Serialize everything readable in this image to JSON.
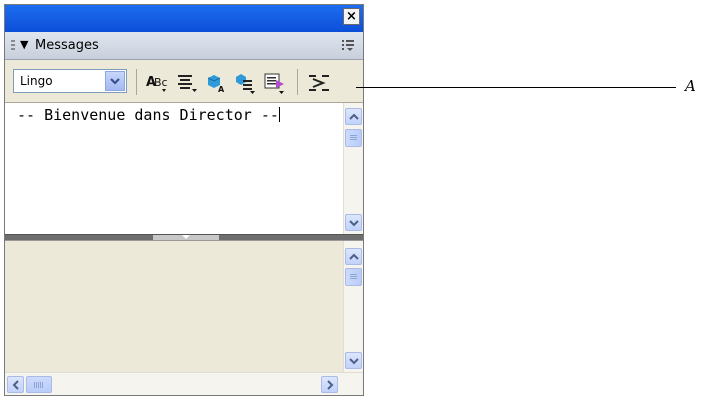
{
  "panel": {
    "title": "Messages",
    "close_label": "×"
  },
  "toolbar": {
    "language_value": "Lingo",
    "icons": [
      "spell-check-icon",
      "text-format-icon",
      "script-object-icon",
      "format-script-icon",
      "script-list-icon",
      "show-handlers-icon"
    ]
  },
  "editor": {
    "text": "-- Bienvenue dans Director --"
  },
  "callout": {
    "label": "A"
  },
  "colors": {
    "titlebar": "#0c4fd8",
    "panel_bg": "#ece9d8",
    "scroll_button": "#c1d2fb"
  }
}
